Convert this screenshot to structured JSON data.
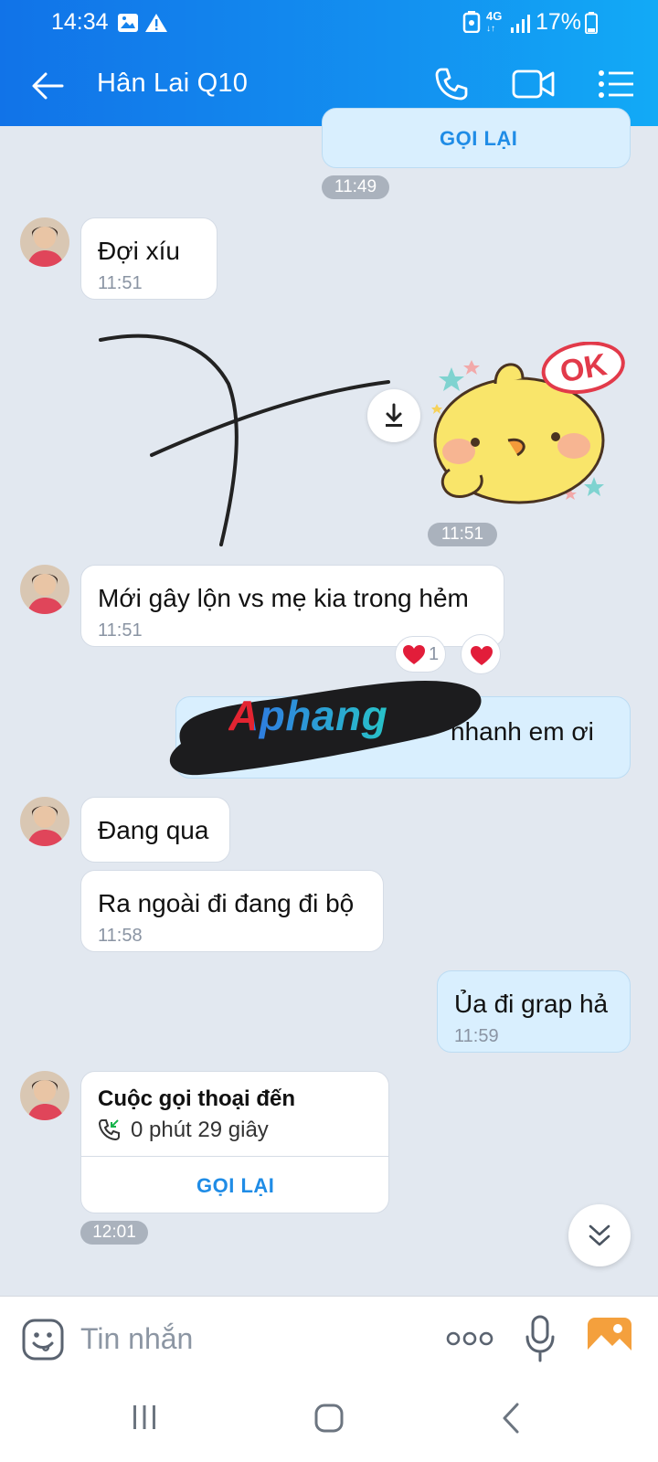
{
  "status_bar": {
    "time": "14:34",
    "network": "4G",
    "battery": "17%"
  },
  "header": {
    "title": "Hân Lai Q10"
  },
  "messages": {
    "top_call_button": "GỌI LẠI",
    "time_1149": "11:49",
    "m1": {
      "text": "Đợi xíu",
      "time": "11:51"
    },
    "sticker_time": "11:51",
    "m2": {
      "text": "Mới gây lộn vs mẹ kia trong hẻm",
      "time": "11:51",
      "reaction_count": "1"
    },
    "m3": {
      "text": "nhanh em ơi"
    },
    "watermark": "Aphang",
    "m4": {
      "text": "Đang qua"
    },
    "m5": {
      "text": "Ra ngoài đi đang đi bộ",
      "time": "11:58"
    },
    "m6": {
      "text": "Ủa đi grap hả",
      "time": "11:59"
    },
    "call": {
      "title": "Cuộc gọi thoại đến",
      "duration": "0 phút 29 giây",
      "button": "GỌI LẠI",
      "time": "12:01"
    }
  },
  "input": {
    "placeholder": "Tin nhắn"
  },
  "colors": {
    "header": "#1390f0",
    "accent": "#1f8ce6",
    "my_bubble": "#d9effe"
  }
}
